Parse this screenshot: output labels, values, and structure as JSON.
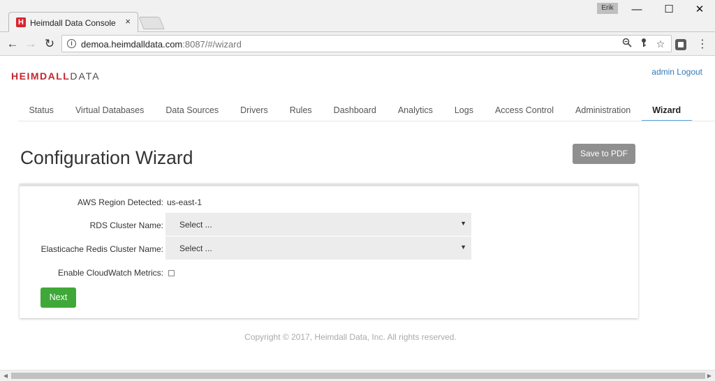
{
  "browser": {
    "tab_title": "Heimdall Data Console",
    "tab_favicon": "H",
    "tab_close": "×",
    "user_badge": "Erik",
    "window_controls": {
      "minimize": "—",
      "maximize": "☐",
      "close": "✕"
    },
    "url_host": "demoa.heimdalldata.com",
    "url_rest": ":8087/#/wizard",
    "icons": [
      "back-icon",
      "forward-icon",
      "reload-icon",
      "info-icon",
      "zoom-icon",
      "key-icon",
      "star-icon",
      "extension-icon",
      "menu-icon"
    ]
  },
  "header": {
    "logo_primary": "HEIMDALL",
    "logo_secondary": "DATA",
    "user": "admin",
    "logout": "Logout"
  },
  "nav": {
    "tabs": [
      {
        "label": "Status"
      },
      {
        "label": "Virtual Databases"
      },
      {
        "label": "Data Sources"
      },
      {
        "label": "Drivers"
      },
      {
        "label": "Rules"
      },
      {
        "label": "Dashboard"
      },
      {
        "label": "Analytics"
      },
      {
        "label": "Logs"
      },
      {
        "label": "Access Control"
      },
      {
        "label": "Administration"
      },
      {
        "label": "Wizard"
      }
    ],
    "active": "Wizard"
  },
  "main": {
    "title": "Configuration Wizard",
    "save_pdf": "Save to PDF",
    "form": {
      "region_label": "AWS Region Detected:",
      "region_value": "us-east-1",
      "rds_label": "RDS Cluster Name:",
      "rds_value": "Select ...",
      "redis_label": "Elasticache Redis Cluster Name:",
      "redis_value": "Select ...",
      "cloudwatch_label": "Enable CloudWatch Metrics:",
      "cloudwatch_checked": false,
      "next_label": "Next"
    },
    "copyright": "Copyright © 2017, Heimdall Data, Inc. All rights reserved."
  },
  "colors": {
    "brand_red": "#c4262e",
    "link_blue": "#337ab7",
    "active_tab_underline": "#5aa6e0",
    "next_green": "#3fa838",
    "pdf_gray": "#8f8f8f"
  }
}
